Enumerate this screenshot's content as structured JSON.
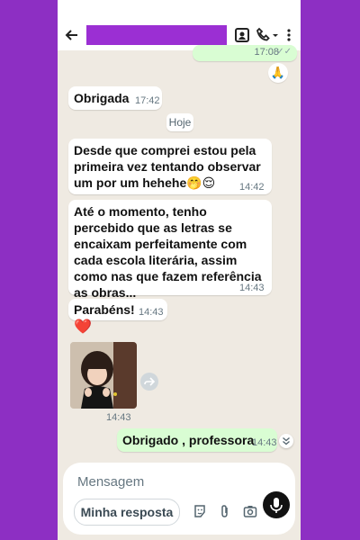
{
  "header": {
    "back_icon": "arrow-left-icon",
    "contact_name_redacted": true,
    "icons": [
      "contact-card-icon",
      "phone-icon",
      "chevron-down-icon",
      "more-vertical-icon"
    ]
  },
  "messages": {
    "first_time": "17:08",
    "reaction_emoji": "🙏",
    "m1_text": "Obrigada",
    "m1_time": "17:42",
    "date_chip": "Hoje",
    "m2_text": "Desde que comprei estou pela primeira vez tentando observar um por um hehehe🤭😌",
    "m2_time": "14:42",
    "m3_text": "Até o momento, tenho percebido que as letras se encaixam perfeitamente com cada escola literária, assim como nas que fazem referência as obras...",
    "m3_time": "14:43",
    "m4_text": "Parabéns!",
    "m4_time": "14:43",
    "m5_emoji": "❤️",
    "sticker_time": "14:43",
    "m6_text": "Obrigado , professora",
    "m6_time": "14:43"
  },
  "composer": {
    "placeholder": "Mensagem",
    "quick_reply": "Minha resposta",
    "icons": [
      "sticker-icon",
      "paperclip-icon",
      "camera-icon",
      "mic-icon"
    ]
  },
  "colors": {
    "frame": "#8d2fc3",
    "chat_bg": "#efeae2",
    "incoming": "#ffffff",
    "outgoing": "#d9fdd3"
  }
}
